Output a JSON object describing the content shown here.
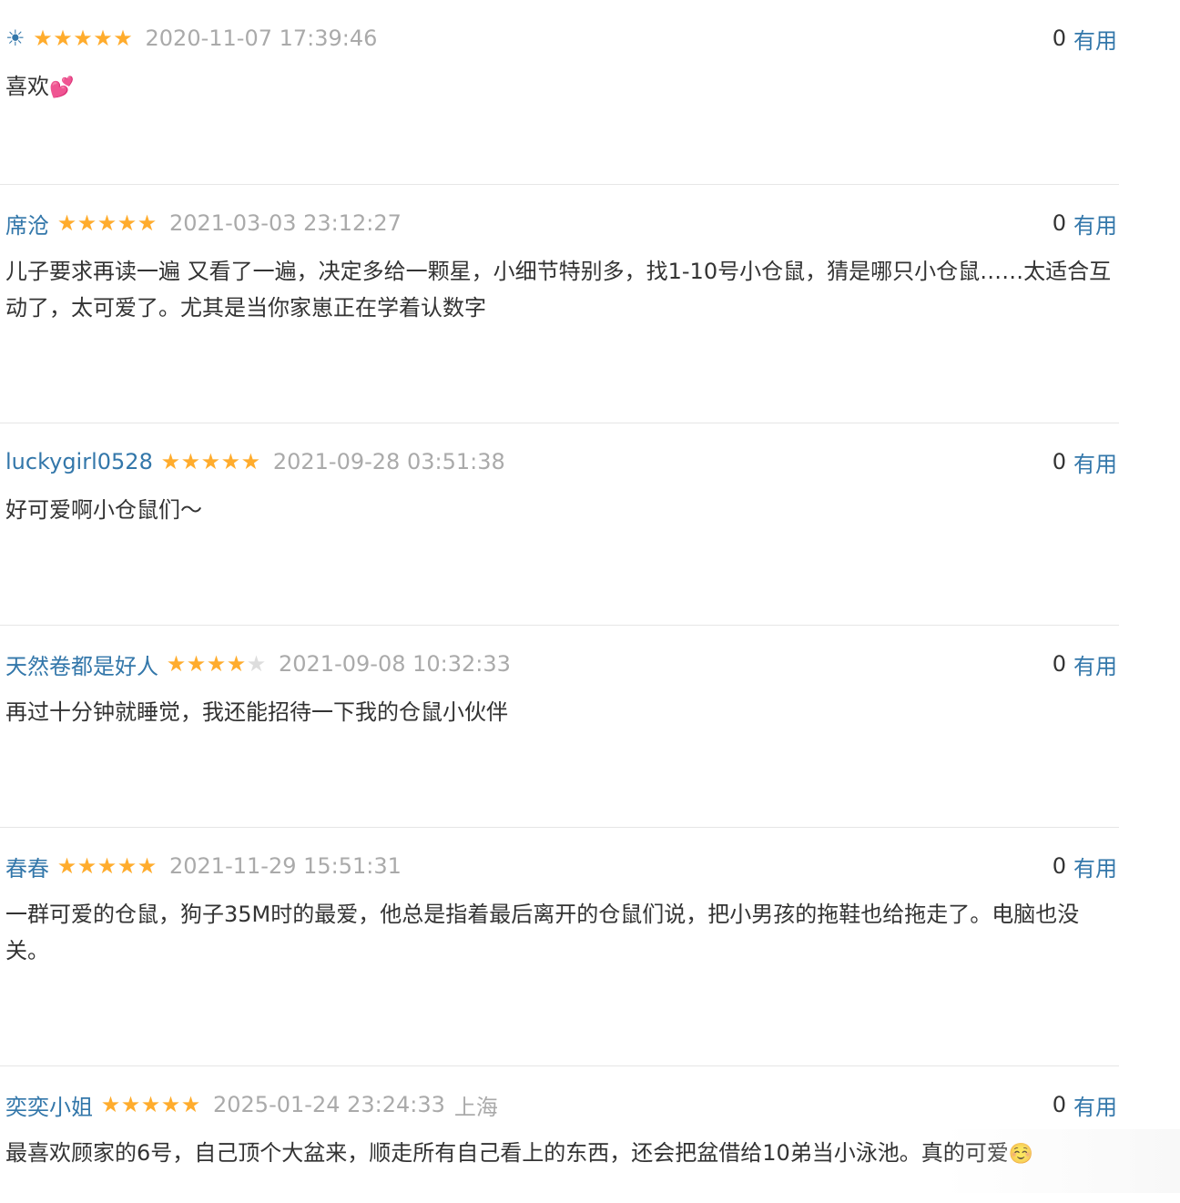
{
  "vote_label": "有用",
  "comments": [
    {
      "author": "",
      "author_icon": "sun-icon",
      "stars": 5,
      "time": "2020-11-07 17:39:46",
      "location": "",
      "votes": "0",
      "content": "喜欢",
      "emoji": "💕"
    },
    {
      "author": "席沧",
      "stars": 5,
      "time": "2021-03-03 23:12:27",
      "location": "",
      "votes": "0",
      "content": "儿子要求再读一遍 又看了一遍，决定多给一颗星，小细节特别多，找1-10号小仓鼠，猜是哪只小仓鼠……太适合互动了，太可爱了。尤其是当你家崽正在学着认数字",
      "emoji": ""
    },
    {
      "author": "luckygirl0528",
      "stars": 5,
      "time": "2021-09-28 03:51:38",
      "location": "",
      "votes": "0",
      "content": "好可爱啊小仓鼠们～",
      "emoji": ""
    },
    {
      "author": "天然卷都是好人",
      "stars": 4,
      "time": "2021-09-08 10:32:33",
      "location": "",
      "votes": "0",
      "content": "再过十分钟就睡觉，我还能招待一下我的仓鼠小伙伴",
      "emoji": ""
    },
    {
      "author": "春春",
      "stars": 5,
      "time": "2021-11-29 15:51:31",
      "location": "",
      "votes": "0",
      "content": "一群可爱的仓鼠，狗子35M时的最爱，他总是指着最后离开的仓鼠们说，把小男孩的拖鞋也给拖走了。电脑也没关。",
      "emoji": ""
    },
    {
      "author": "奕奕小姐",
      "stars": 5,
      "time": "2025-01-24 23:24:33",
      "location": "上海",
      "votes": "0",
      "content": "最喜欢顾家的6号，自己顶个大盆来，顺走所有自己看上的东西，还会把盆借给10弟当小泳池。真的可爱",
      "emoji": "☺️"
    }
  ]
}
